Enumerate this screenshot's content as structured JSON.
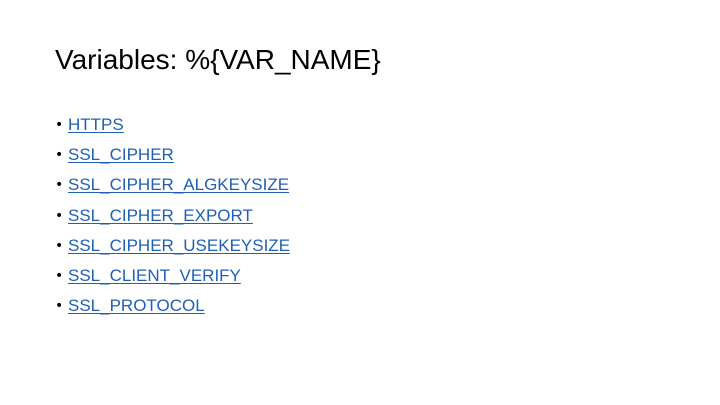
{
  "slide": {
    "title": "Variables: %{VAR_NAME}",
    "bullet_symbol": "•",
    "link_color": "#1f5fb4",
    "items": [
      {
        "label": "HTTPS"
      },
      {
        "label": "SSL_CIPHER"
      },
      {
        "label": "SSL_CIPHER_ALGKEYSIZE"
      },
      {
        "label": "SSL_CIPHER_EXPORT"
      },
      {
        "label": "SSL_CIPHER_USEKEYSIZE"
      },
      {
        "label": "SSL_CLIENT_VERIFY"
      },
      {
        "label": "SSL_PROTOCOL"
      }
    ]
  }
}
